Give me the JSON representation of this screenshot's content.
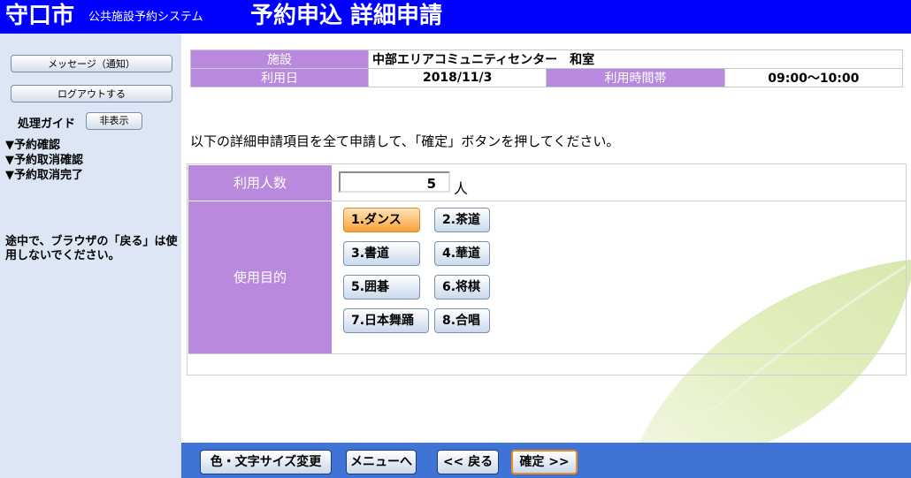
{
  "header": {
    "city": "守口市",
    "system": "公共施設予約システム",
    "page_title": "予約申込 詳細申請"
  },
  "sidebar": {
    "message_button": "メッセージ（通知）",
    "logout_button": "ログアウトする",
    "guide_label": "処理ガイド",
    "hide_button": "非表示",
    "guide_items": [
      "▼予約確認",
      "▼予約取消確認",
      "▼予約取消完了"
    ],
    "note": "途中で、ブラウザの「戻る」は使用しないでください。"
  },
  "info": {
    "facility_label": "施設",
    "facility_value": "中部エリアコミュニティセンター　和室",
    "date_label": "利用日",
    "date_value": "2018/11/3",
    "time_label": "利用時間帯",
    "time_value": "09:00～10:00"
  },
  "instruction": "以下の詳細申請項目を全て申請して、「確定」ボタンを押してください。",
  "form": {
    "count_label": "利用人数",
    "count_value": "5",
    "count_unit": "人",
    "purpose_label": "使用目的",
    "purposes": [
      "1.ダンス",
      "2.茶道",
      "3.書道",
      "4.華道",
      "5.囲碁",
      "6.将棋",
      "7.日本舞踊",
      "8.合唱"
    ],
    "selected_purpose": "1.ダンス"
  },
  "footer": {
    "color_button": "色・文字サイズ変更",
    "menu_button": "メニューへ",
    "back_button": "<< 戻る",
    "confirm_button": "確定 >>"
  },
  "colors": {
    "header": "#0000ff",
    "sidebar": "#dce6f4",
    "label": "#b889dc",
    "footer": "#3f74d6",
    "selected": "#f7a23b"
  }
}
